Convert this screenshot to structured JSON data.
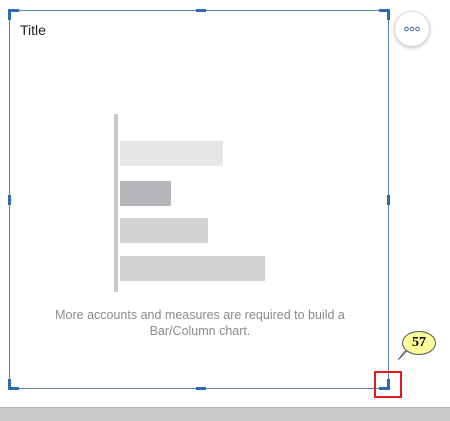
{
  "widget": {
    "title": "Title",
    "message": "More accounts and measures are required to build a Bar/Column chart."
  },
  "placeholder_bars": [
    {
      "fraction": 0.67,
      "color": "#e6e6e6"
    },
    {
      "fraction": 0.33,
      "color": "#b5b6b9"
    },
    {
      "fraction": 0.57,
      "color": "#d3d3d3"
    },
    {
      "fraction": 0.94,
      "color": "#d3d3d3"
    }
  ],
  "more_button": {
    "icon": "more-horizontal-icon"
  },
  "annotation": {
    "label": "57",
    "color": "#ffff99",
    "highlight_color": "#e01b1b"
  },
  "colors": {
    "selection": "#2d6ab3",
    "frame": "#5b7fb3"
  }
}
